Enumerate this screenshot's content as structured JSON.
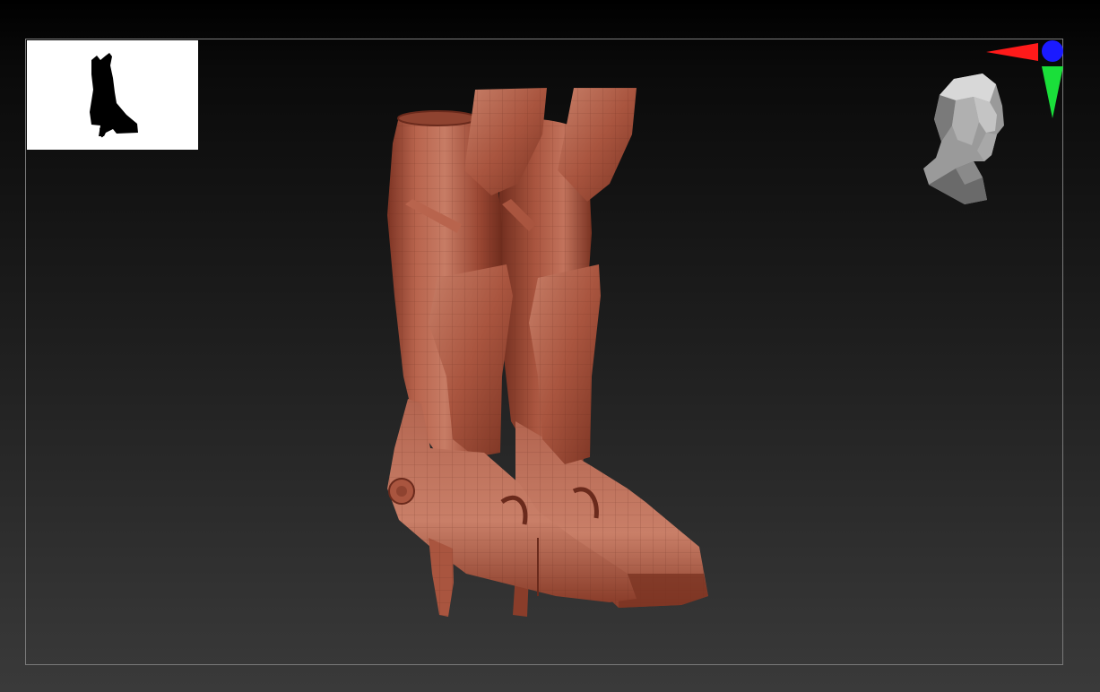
{
  "viewport": {
    "background_top": "#000000",
    "background_bottom": "#3a3a3a",
    "frame_color": "#7a7a7a"
  },
  "thumbnail": {
    "icon": "boot-silhouette-icon",
    "background": "#ffffff",
    "silhouette_color": "#000000"
  },
  "model": {
    "icon": "boots-sculpt-model",
    "material_color": "#a9553f"
  },
  "navigation": {
    "head_icon": "orientation-head-icon",
    "gizmo_icon": "axis-gizmo-icon",
    "axis_colors": {
      "x": "#ff1a1a",
      "y": "#1adf3a",
      "z": "#1a1aff"
    }
  }
}
